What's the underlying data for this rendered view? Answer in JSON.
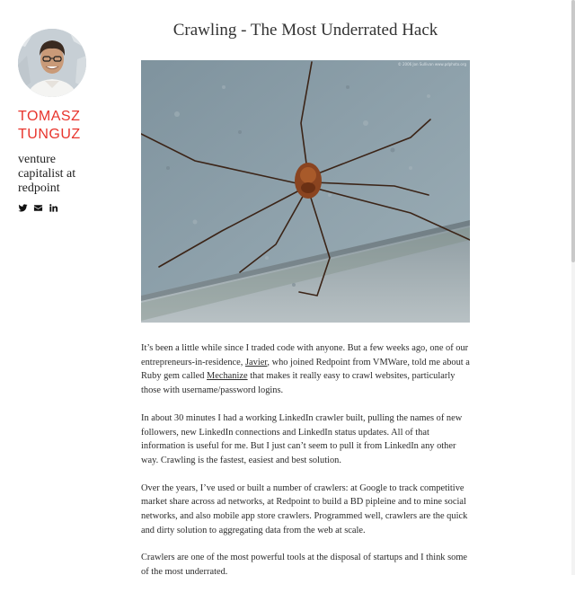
{
  "author": {
    "name_line1": "TOMASZ",
    "name_line2": "TUNGUZ",
    "tagline": "venture capitalist at redpoint",
    "avatar_icon": "author-portrait",
    "social": [
      {
        "icon": "twitter-icon"
      },
      {
        "icon": "email-icon"
      },
      {
        "icon": "linkedin-icon"
      }
    ]
  },
  "post": {
    "title": "Crawling - The Most Underrated Hack",
    "image_credit": "© 2006 Jon Sullivan www.pdphoto.org",
    "paragraphs": [
      {
        "t1": "It’s been a little while since I traded code with anyone. But a few weeks ago, one of our entrepreneurs-in-residence, ",
        "link1": "Javier",
        "t2": ", who joined Redpoint from VMWare, told me about a Ruby gem called ",
        "link2": "Mechanize",
        "t3": " that makes it really easy to crawl websites, particularly those with username/password logins."
      },
      "In about 30 minutes I had a working LinkedIn crawler built, pulling the names of new followers, new LinkedIn connections and LinkedIn status updates. All of that information is useful for me. But I just can’t seem to pull it from LinkedIn any other way. Crawling is the fastest, easiest and best solution.",
      "Over the years, I’ve used or built a number of crawlers: at Google to track competitive market share across ad networks, at Redpoint to build a BD pipleine and to mine social networks, and also mobile app store crawlers. Programmed well, crawlers are the quick and dirty solution to aggregating data from the web at scale.",
      "Crawlers are one of the most powerful tools at the disposal of startups and I think some of the most underrated."
    ]
  },
  "colors": {
    "name_red": "#e8352d",
    "text": "#2b2b2b",
    "background": "#ffffff"
  }
}
